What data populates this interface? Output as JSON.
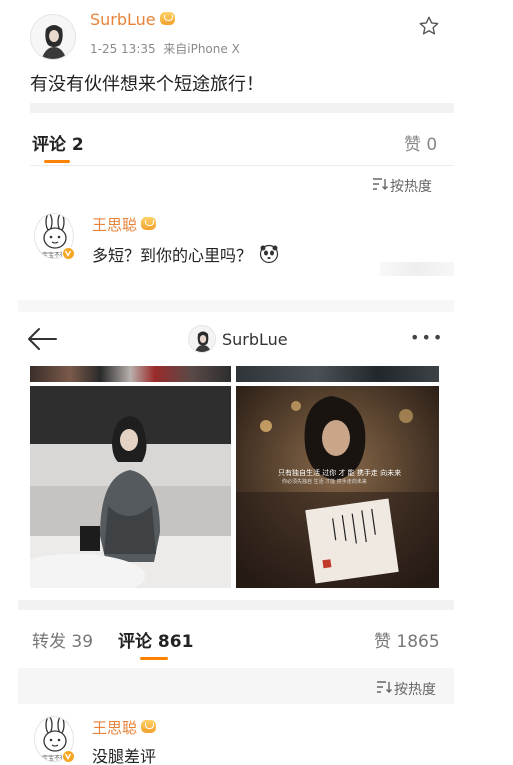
{
  "post": {
    "username": "SurbLue",
    "meta": "1-25 13:35  来自iPhone X",
    "text": "有没有伙伴想来个短途旅行！"
  },
  "comments_bar_top": {
    "comments_label": "评论 2",
    "likes_label": "赞 0",
    "sort_label": "按热度"
  },
  "comment_top": {
    "username": "王思聪",
    "text": "多短？到你的心里吗？"
  },
  "repost_screen": {
    "header_username": "SurbLue",
    "more_label": "•••",
    "subtitle_1": "只有独自生活 过你 才 能 携手走 向未来",
    "subtitle_2": "你必须先独自 生活 才能 携手走向未来"
  },
  "comments_bar_bottom": {
    "repost_label": "转发 39",
    "comments_label": "评论 861",
    "likes_label": "赞 1865",
    "sort_label": "按热度"
  },
  "comment_bottom": {
    "username": "王思聪",
    "text": "没腿差评"
  },
  "colors": {
    "accent": "#ff8200",
    "username": "#e8833a"
  },
  "icons": [
    "star-icon",
    "vip-badge-icon",
    "sort-icon",
    "back-arrow-icon",
    "more-icon",
    "panda-emoji-icon",
    "verified-badge-icon"
  ]
}
